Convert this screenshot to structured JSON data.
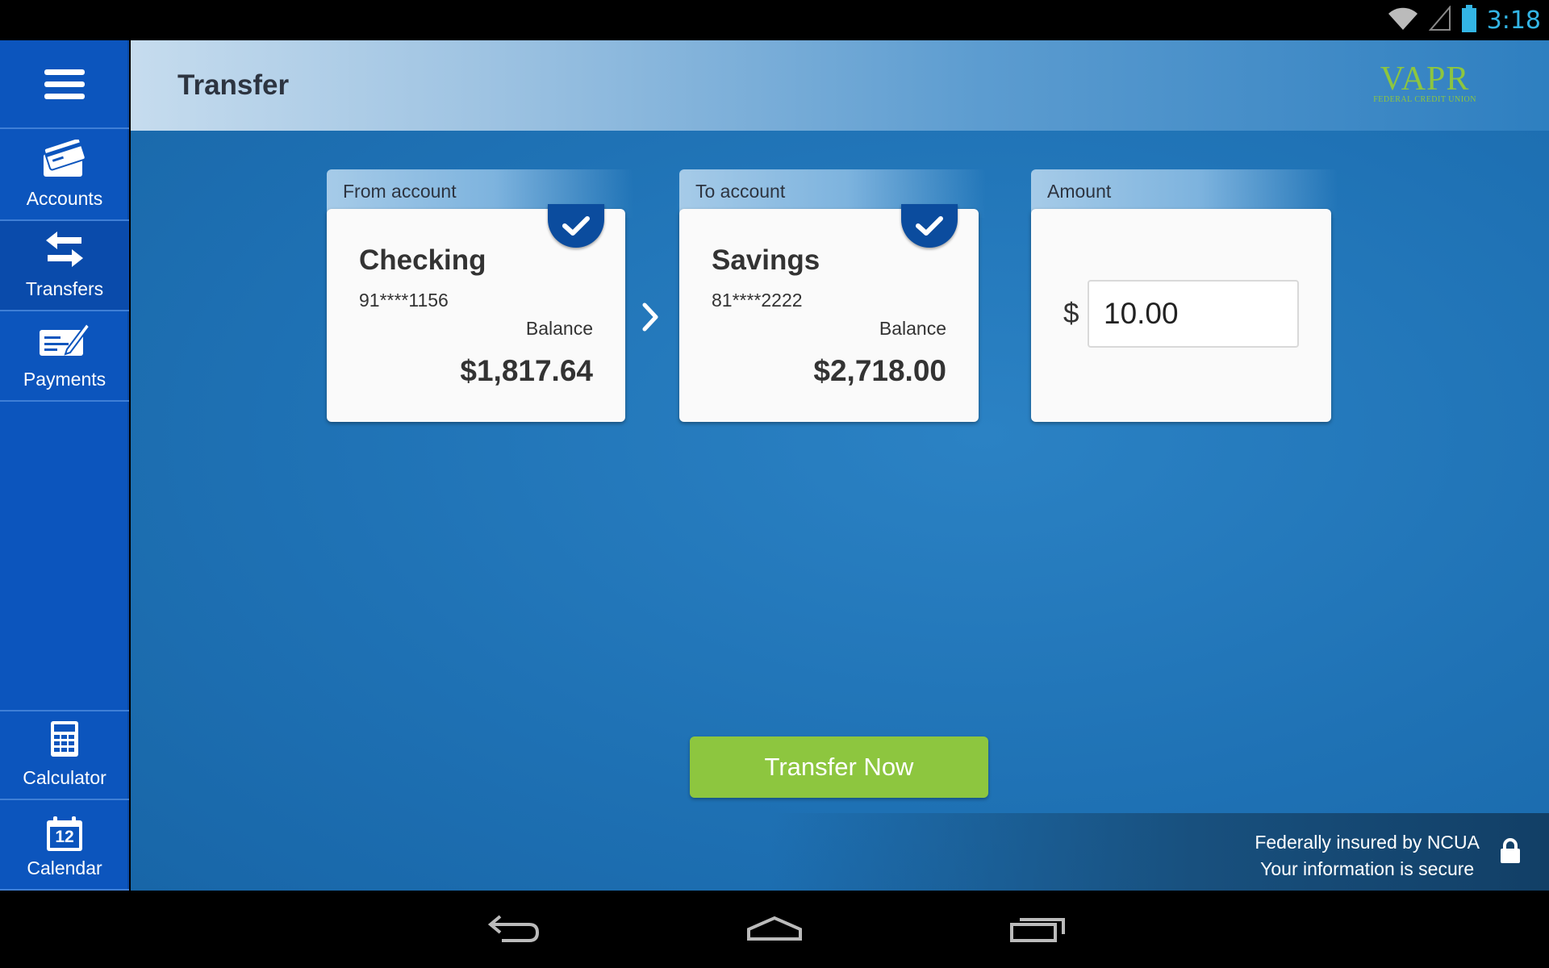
{
  "status_bar": {
    "time": "3:18"
  },
  "sidebar": {
    "items": [
      {
        "label": "Accounts",
        "icon": "credit-card-icon"
      },
      {
        "label": "Transfers",
        "icon": "transfer-arrows-icon"
      },
      {
        "label": "Payments",
        "icon": "check-pen-icon"
      }
    ],
    "bottom_items": [
      {
        "label": "Calculator",
        "icon": "calculator-icon"
      },
      {
        "label": "Calendar",
        "icon": "calendar-icon",
        "day": "12"
      }
    ]
  },
  "header": {
    "title": "Transfer",
    "logo_main": "VAPR",
    "logo_sub": "FEDERAL CREDIT UNION"
  },
  "from": {
    "tab_label": "From account",
    "name": "Checking",
    "number": "91****1156",
    "balance_label": "Balance",
    "balance": "$1,817.64"
  },
  "to": {
    "tab_label": "To account",
    "name": "Savings",
    "number": "81****2222",
    "balance_label": "Balance",
    "balance": "$2,718.00"
  },
  "amount": {
    "tab_label": "Amount",
    "currency": "$",
    "value": "10.00"
  },
  "actions": {
    "transfer_label": "Transfer Now"
  },
  "footer": {
    "line1": "Federally insured by NCUA",
    "line2": "Your information is secure"
  },
  "colors": {
    "sidebar": "#0c55bd",
    "accent_green": "#8dc63f",
    "badge_blue": "#0b4c9e",
    "status_clock": "#33b5e5"
  }
}
